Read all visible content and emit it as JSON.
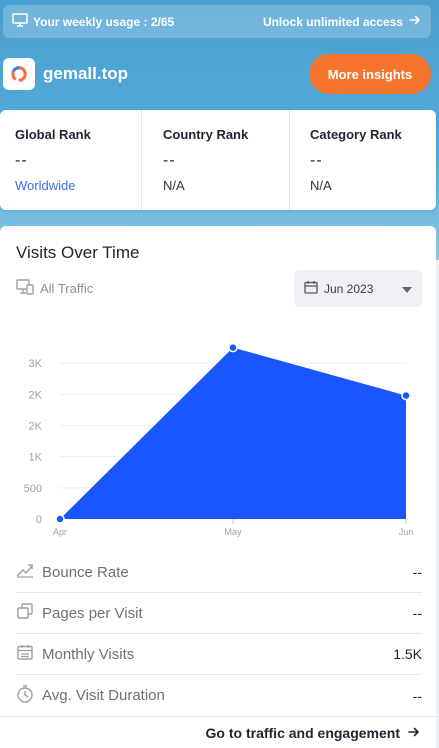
{
  "usage": {
    "text": "Your weekly usage : 2/65",
    "unlock_label": "Unlock unlimited access"
  },
  "site": {
    "name": "gemall.top",
    "insights_button": "More insights"
  },
  "ranks": [
    {
      "title": "Global Rank",
      "value": "--",
      "sub": "Worldwide"
    },
    {
      "title": "Country Rank",
      "value": "--",
      "sub": "N/A"
    },
    {
      "title": "Category Rank",
      "value": "--",
      "sub": "N/A"
    }
  ],
  "visits": {
    "title": "Visits Over Time",
    "traffic_label": "All Traffic",
    "date_selected": "Jun 2023"
  },
  "chart_data": {
    "type": "area",
    "x": [
      "Apr",
      "May",
      "Jun"
    ],
    "values": [
      0,
      2750,
      1980
    ],
    "yticks": [
      "0",
      "500",
      "1K",
      "2K",
      "2K",
      "3K"
    ],
    "ytick_values": [
      0,
      500,
      1000,
      1500,
      2000,
      2500
    ],
    "ylim": [
      0,
      3000
    ],
    "grid": true,
    "color": "#1a56ff"
  },
  "metrics": [
    {
      "icon": "trend-icon",
      "label": "Bounce Rate",
      "value": "--"
    },
    {
      "icon": "pages-icon",
      "label": "Pages per Visit",
      "value": "--"
    },
    {
      "icon": "calendar-icon",
      "label": "Monthly Visits",
      "value": "1.5K"
    },
    {
      "icon": "timer-icon",
      "label": "Avg. Visit Duration",
      "value": "--"
    }
  ],
  "footer": {
    "link_label": "Go to traffic and engagement"
  },
  "colors": {
    "accent": "#f5742e",
    "link": "#3c6fe0",
    "chart": "#1a56ff"
  }
}
